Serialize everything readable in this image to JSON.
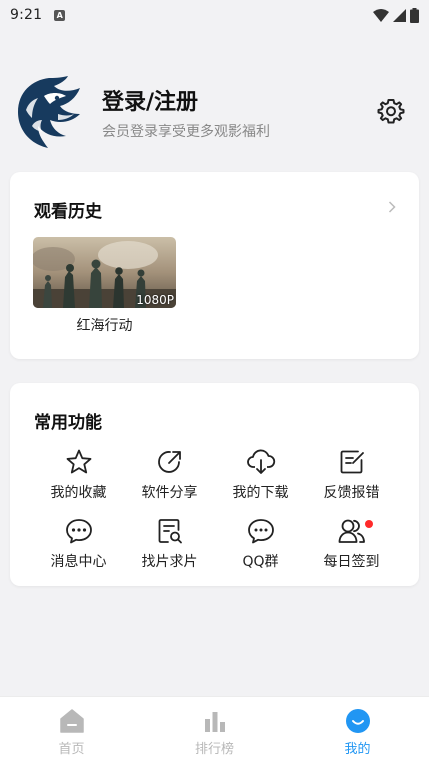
{
  "status_bar": {
    "time": "9:21",
    "a_indicator": "A"
  },
  "profile": {
    "title": "登录/注册",
    "subtitle": "会员登录享受更多观影福利"
  },
  "history": {
    "title": "观看历史",
    "items": [
      {
        "title": "红海行动",
        "quality": "1080P"
      }
    ]
  },
  "functions": {
    "title": "常用功能",
    "items": [
      {
        "label": "我的收藏",
        "icon": "star-icon"
      },
      {
        "label": "软件分享",
        "icon": "share-icon"
      },
      {
        "label": "我的下载",
        "icon": "cloud-download-icon"
      },
      {
        "label": "反馈报错",
        "icon": "feedback-icon"
      },
      {
        "label": "消息中心",
        "icon": "message-icon"
      },
      {
        "label": "找片求片",
        "icon": "search-document-icon"
      },
      {
        "label": "QQ群",
        "icon": "chat-icon"
      },
      {
        "label": "每日签到",
        "icon": "users-icon",
        "has_dot": true
      }
    ]
  },
  "tabbar": {
    "tabs": [
      {
        "label": "首页",
        "active": false
      },
      {
        "label": "排行榜",
        "active": false
      },
      {
        "label": "我的",
        "active": true
      }
    ]
  },
  "colors": {
    "accent": "#2196f3",
    "inactive": "#b8b8b8",
    "badge_dot": "#ff2a2a"
  }
}
